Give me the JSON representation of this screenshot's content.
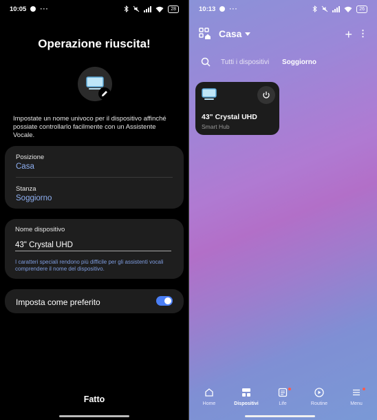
{
  "left": {
    "status": {
      "time": "10:05",
      "dots": "···",
      "battery": "28"
    },
    "title": "Operazione riuscita!",
    "description": "Impostate un nome univoco per il dispositivo affinché possiate controllarlo facilmente con un Assistente Vocale.",
    "location": {
      "position_label": "Posizione",
      "position_value": "Casa",
      "room_label": "Stanza",
      "room_value": "Soggiorno"
    },
    "device_name": {
      "label": "Nome dispositivo",
      "value": "43\" Crystal UHD",
      "hint": "I caratteri speciali rendono più difficile per gli assistenti vocali comprendere il nome del dispositivo."
    },
    "favorite": {
      "label": "Imposta come preferito",
      "enabled": true
    },
    "done_label": "Fatto"
  },
  "right": {
    "status": {
      "time": "10:13",
      "dots": "···",
      "battery": "26"
    },
    "home_name": "Casa",
    "filters": {
      "all": "Tutti i dispositivi",
      "room": "Soggiorno"
    },
    "device": {
      "name": "43\" Crystal UHD",
      "subtitle": "Smart Hub"
    },
    "nav": {
      "home": "Home",
      "devices": "Dispositivi",
      "life": "Life",
      "routine": "Routine",
      "menu": "Menu"
    }
  },
  "colors": {
    "accent": "#4a7ef5",
    "link": "#8fb0f2",
    "badge": "#ff5a4a"
  }
}
